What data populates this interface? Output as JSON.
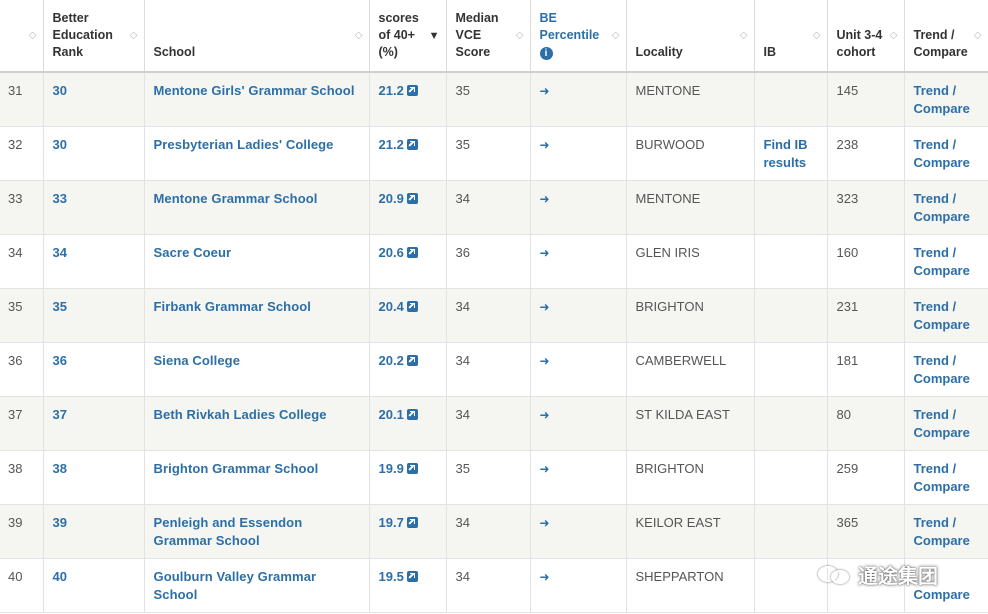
{
  "columns": [
    {
      "label": "",
      "sortable": true
    },
    {
      "label": "Better Education Rank",
      "sortable": true
    },
    {
      "label": "School",
      "sortable": true
    },
    {
      "label": "scores of 40+ (%)",
      "sortable": true,
      "active_sort": "descending"
    },
    {
      "label": "Median VCE Score",
      "sortable": true
    },
    {
      "label": "BE Percentile",
      "sortable": true,
      "has_info_icon": true
    },
    {
      "label": "Locality",
      "sortable": true
    },
    {
      "label": "IB",
      "sortable": true
    },
    {
      "label": "Unit 3-4 cohort",
      "sortable": true
    },
    {
      "label": "Trend / Compare",
      "sortable": true
    }
  ],
  "rows": [
    {
      "index": "31",
      "rank": "30",
      "school": "Mentone Girls' Grammar School",
      "score": "21.2",
      "median": "35",
      "locality": "MENTONE",
      "ib": "",
      "cohort": "145",
      "trend": "Trend / Compare"
    },
    {
      "index": "32",
      "rank": "30",
      "school": "Presbyterian Ladies' College",
      "score": "21.2",
      "median": "35",
      "locality": "BURWOOD",
      "ib": "Find IB results",
      "cohort": "238",
      "trend": "Trend / Compare"
    },
    {
      "index": "33",
      "rank": "33",
      "school": "Mentone Grammar School",
      "score": "20.9",
      "median": "34",
      "locality": "MENTONE",
      "ib": "",
      "cohort": "323",
      "trend": "Trend / Compare"
    },
    {
      "index": "34",
      "rank": "34",
      "school": "Sacre Coeur",
      "score": "20.6",
      "median": "36",
      "locality": "GLEN IRIS",
      "ib": "",
      "cohort": "160",
      "trend": "Trend / Compare"
    },
    {
      "index": "35",
      "rank": "35",
      "school": "Firbank Grammar School",
      "score": "20.4",
      "median": "34",
      "locality": "BRIGHTON",
      "ib": "",
      "cohort": "231",
      "trend": "Trend / Compare"
    },
    {
      "index": "36",
      "rank": "36",
      "school": "Siena College",
      "score": "20.2",
      "median": "34",
      "locality": "CAMBERWELL",
      "ib": "",
      "cohort": "181",
      "trend": "Trend / Compare"
    },
    {
      "index": "37",
      "rank": "37",
      "school": "Beth Rivkah Ladies College",
      "score": "20.1",
      "median": "34",
      "locality": "ST KILDA EAST",
      "ib": "",
      "cohort": "80",
      "trend": "Trend / Compare"
    },
    {
      "index": "38",
      "rank": "38",
      "school": "Brighton Grammar School",
      "score": "19.9",
      "median": "35",
      "locality": "BRIGHTON",
      "ib": "",
      "cohort": "259",
      "trend": "Trend / Compare"
    },
    {
      "index": "39",
      "rank": "39",
      "school": "Penleigh and Essendon Grammar School",
      "score": "19.7",
      "median": "34",
      "locality": "KEILOR EAST",
      "ib": "",
      "cohort": "365",
      "trend": "Trend / Compare"
    },
    {
      "index": "40",
      "rank": "40",
      "school": "Goulburn Valley Grammar School",
      "score": "19.5",
      "median": "34",
      "locality": "SHEPPARTON",
      "ib": "",
      "cohort": "",
      "trend": "Compare"
    }
  ],
  "watermark": {
    "text": "通途集团"
  },
  "colors": {
    "link": "#2c6fa8",
    "row_alt": "#f5f5f2",
    "border": "#e2e2e2"
  },
  "icons": {
    "sort": "sort-updown-icon",
    "score_link": "external-link-icon",
    "percentile": "sign-in-icon",
    "info": "info-circle-icon"
  }
}
